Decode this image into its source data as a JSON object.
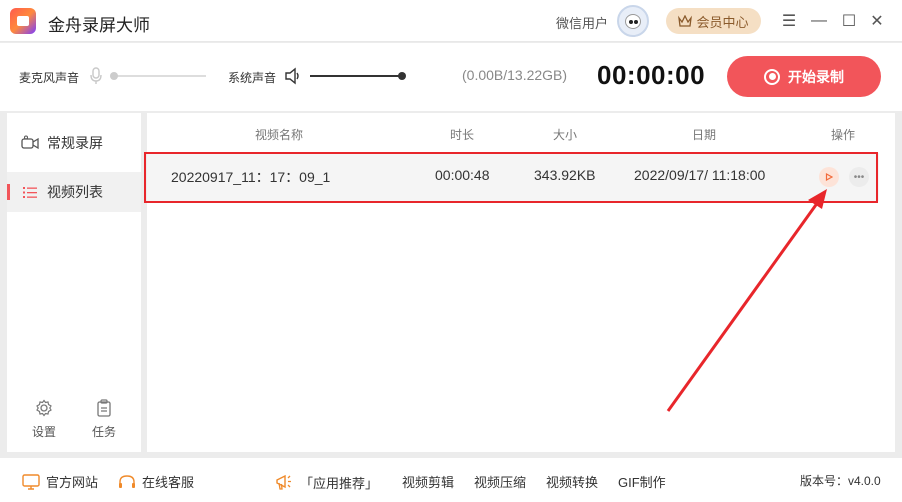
{
  "app": {
    "title": "金舟录屏大师",
    "user_name": "微信用户",
    "vip_label": "会员中心"
  },
  "window_controls": {
    "menu": "☰",
    "minimize": "—",
    "maximize": "☐",
    "close": "✕"
  },
  "toolbar": {
    "mic_label": "麦克风声音",
    "mic_level": 0.0,
    "system_label": "系统声音",
    "system_level": 1.0,
    "storage": "(0.00B/13.22GB)",
    "timer": "00:00:00",
    "record_label": "开始录制"
  },
  "sidebar": {
    "items": [
      {
        "label": "常规录屏",
        "icon": "camera-icon"
      },
      {
        "label": "视频列表",
        "icon": "list-icon",
        "active": true
      }
    ],
    "settings_label": "设置",
    "tasks_label": "任务"
  },
  "table": {
    "headers": {
      "name": "视频名称",
      "duration": "时长",
      "size": "大小",
      "date": "日期",
      "actions": "操作"
    },
    "rows": [
      {
        "name": "20220917_11：17：09_1",
        "duration": "00:00:48",
        "size": "343.92KB",
        "date": "2022/09/17/ 11:18:00"
      }
    ]
  },
  "footer": {
    "website": "官方网站",
    "support": "在线客服",
    "recommend": "「应用推荐」",
    "links": [
      "视频剪辑",
      "视频压缩",
      "视频转换",
      "GIF制作"
    ],
    "version": "版本号：v4.0.0"
  },
  "colors": {
    "accent": "#f2555a",
    "annotation": "#e8262b",
    "vip": "#f5dfc4"
  }
}
